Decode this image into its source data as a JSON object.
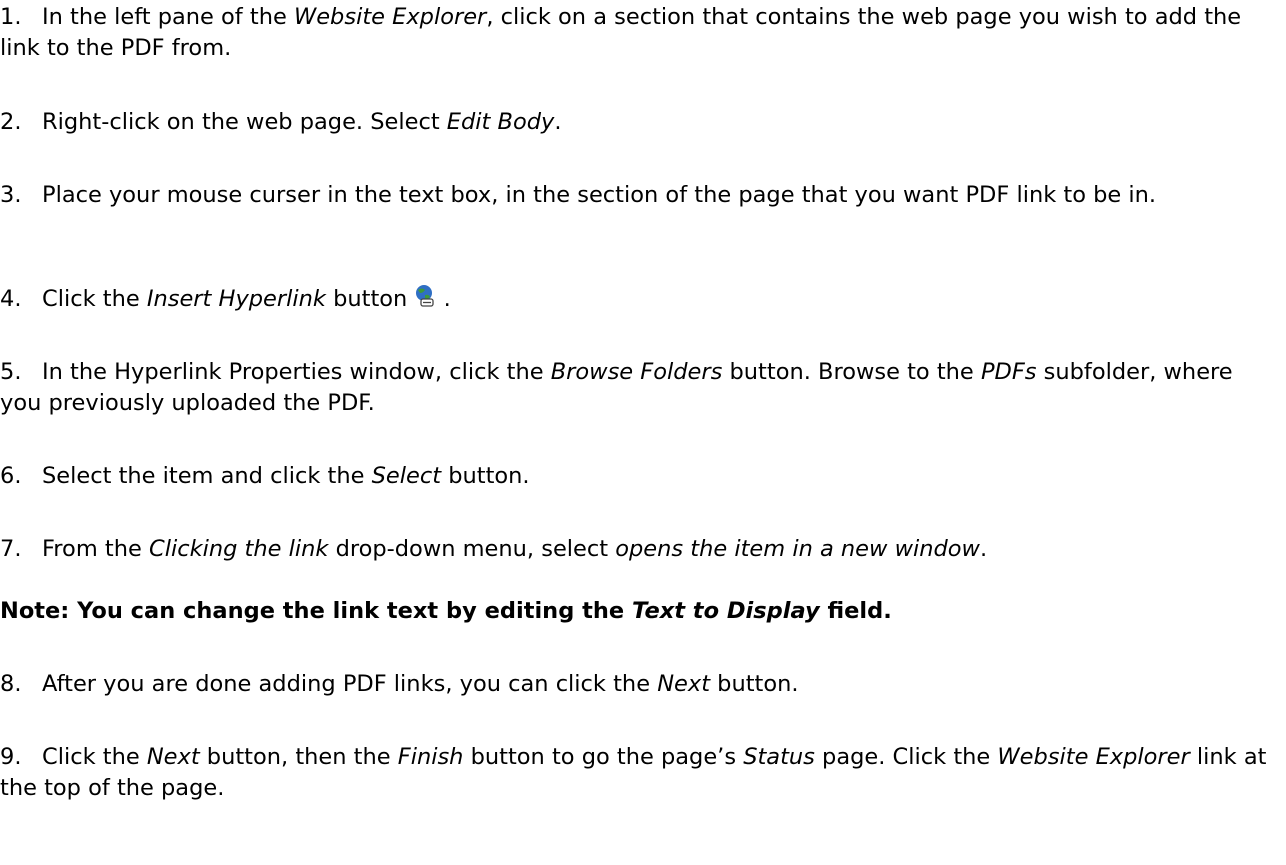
{
  "steps": [
    {
      "num": "1.",
      "parts": [
        {
          "t": "In the left pane of the ",
          "i": false
        },
        {
          "t": "Website Explorer",
          "i": true
        },
        {
          "t": ", click on a section that contains the web page you wish to add the link to the PDF from.",
          "i": false
        }
      ]
    },
    {
      "num": "2.",
      "parts": [
        {
          "t": "Right-click on the web page. Select ",
          "i": false
        },
        {
          "t": "Edit Body",
          "i": true
        },
        {
          "t": ".",
          "i": false
        }
      ]
    },
    {
      "num": "3.",
      "parts": [
        {
          "t": "Place your mouse curser in the text box, in the section of the page that you want PDF link to be in.",
          "i": false
        }
      ]
    },
    {
      "num": "4.",
      "parts": [
        {
          "t": "Click the ",
          "i": false
        },
        {
          "t": "Insert Hyperlink",
          "i": true
        },
        {
          "t": " button ",
          "i": false
        },
        {
          "icon": "insert-hyperlink-globe-icon"
        },
        {
          "t": " .",
          "i": false
        }
      ]
    },
    {
      "num": "5.",
      "parts": [
        {
          "t": "In the Hyperlink Properties window, click the ",
          "i": false
        },
        {
          "t": "Browse Folders",
          "i": true
        },
        {
          "t": " button. Browse to the ",
          "i": false
        },
        {
          "t": "PDFs",
          "i": true
        },
        {
          "t": " subfolder, where you previously uploaded the PDF.",
          "i": false
        }
      ]
    },
    {
      "num": "6.",
      "parts": [
        {
          "t": "Select the item and click the ",
          "i": false
        },
        {
          "t": "Select",
          "i": true
        },
        {
          "t": " button.",
          "i": false
        }
      ]
    },
    {
      "num": "7.",
      "parts": [
        {
          "t": "From the ",
          "i": false
        },
        {
          "t": "Clicking the link",
          "i": true
        },
        {
          "t": " drop-down menu, select ",
          "i": false
        },
        {
          "t": "opens the item in a new window",
          "i": true
        },
        {
          "t": ".",
          "i": false
        }
      ]
    },
    {
      "num": "8.",
      "parts": [
        {
          "t": "After you are done adding PDF links, you can click the ",
          "i": false
        },
        {
          "t": "Next",
          "i": true
        },
        {
          "t": " button.",
          "i": false
        }
      ]
    },
    {
      "num": "9.",
      "parts": [
        {
          "t": "Click the ",
          "i": false
        },
        {
          "t": "Next",
          "i": true
        },
        {
          "t": " button, then the ",
          "i": false
        },
        {
          "t": "Finish",
          "i": true
        },
        {
          "t": " button to go the page’s ",
          "i": false
        },
        {
          "t": "Status",
          "i": true
        },
        {
          "t": " page. Click the ",
          "i": false
        },
        {
          "t": "Website Explorer",
          "i": true
        },
        {
          "t": " link at the top of the page.",
          "i": false
        }
      ]
    }
  ],
  "note": {
    "before": "Note: You can change the link text by editing the ",
    "italic": "Text to Display",
    "after": " field."
  },
  "colors": {
    "text": "#000000",
    "background": "#ffffff",
    "globe_blue": "#2f6fc4",
    "globe_green": "#3c9a3c"
  }
}
